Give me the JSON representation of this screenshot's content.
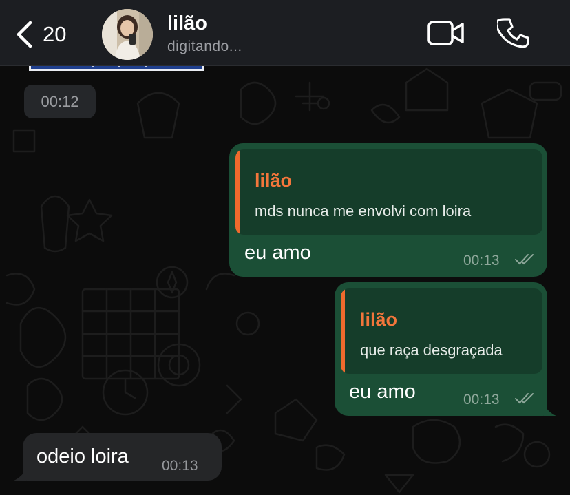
{
  "header": {
    "back_count": "20",
    "contact_name": "lilão",
    "contact_status": "digitando...",
    "icons": [
      "chevron-left-icon",
      "video-camera-icon",
      "phone-icon"
    ]
  },
  "chat": {
    "time_separator": "00:12",
    "messages": [
      {
        "direction": "outgoing",
        "reply_to_name": "lilão",
        "reply_to_text": "mds nunca me envolvi com loira",
        "text": "eu amo",
        "time": "00:13",
        "status": "read"
      },
      {
        "direction": "outgoing",
        "reply_to_name": "lilão",
        "reply_to_text": "que raça desgraçada",
        "text": "eu amo",
        "time": "00:13",
        "status": "read"
      },
      {
        "direction": "incoming",
        "text": "odeio loira",
        "time": "00:13"
      }
    ]
  },
  "colors": {
    "outgoing_bubble": "#1b4f36",
    "quote_background": "#153d2a",
    "quote_accent": "#f06a2d",
    "incoming_bubble": "#252628",
    "header_background": "#1c1e22",
    "chat_background": "#0c0c0c"
  }
}
